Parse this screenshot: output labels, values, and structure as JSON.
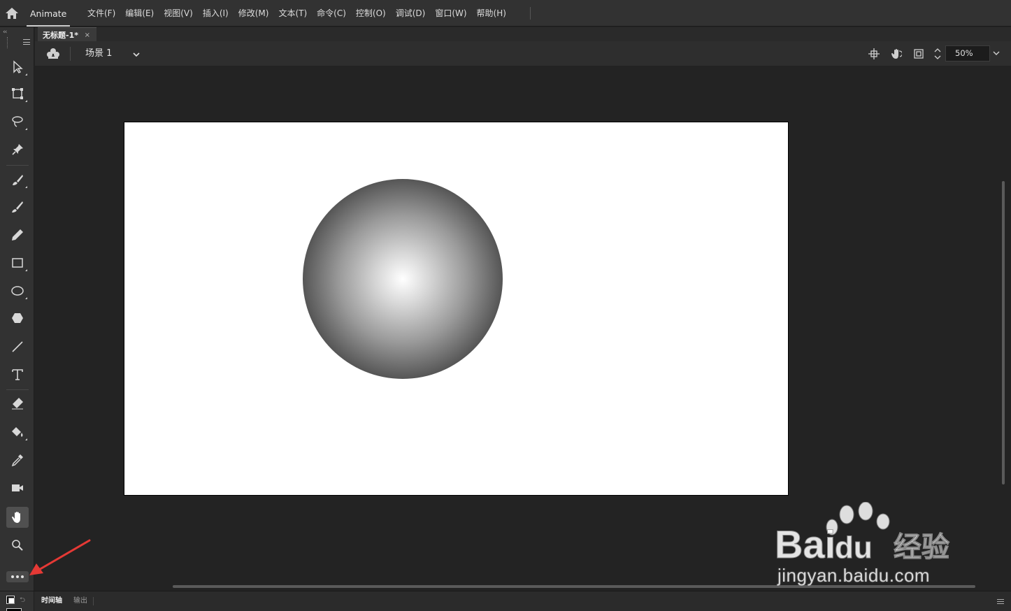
{
  "app": {
    "name": "Animate"
  },
  "menu": {
    "items": [
      "文件(F)",
      "编辑(E)",
      "视图(V)",
      "插入(I)",
      "修改(M)",
      "文本(T)",
      "命令(C)",
      "控制(O)",
      "调试(D)",
      "窗口(W)",
      "帮助(H)"
    ]
  },
  "document": {
    "tab_title": "无标题-1*",
    "close_glyph": "×"
  },
  "scene": {
    "label": "场景 1",
    "zoom": "50%"
  },
  "toolbar": {
    "collapse_glyph": "‹‹",
    "tools": [
      "selection-tool",
      "free-transform-tool",
      "lasso-tool",
      "pin-tool",
      "paint-brush-tool",
      "brush-tool",
      "pencil-tool",
      "rectangle-tool",
      "oval-tool",
      "polystar-tool",
      "line-tool",
      "text-tool",
      "eraser-tool",
      "paint-bucket-tool",
      "eyedropper-tool",
      "camera-tool",
      "hand-tool",
      "zoom-tool"
    ],
    "active_tool": "hand-tool"
  },
  "bottom_panel": {
    "tabs": [
      "时间轴",
      "输出"
    ],
    "active": "时间轴",
    "swap_glyph": "⮌"
  },
  "colors": {
    "ui_background": "#232323",
    "panel": "#323232",
    "stage": "#ffffff",
    "gradient_center": "#ffffff",
    "gradient_edge": "#000000",
    "annotation_arrow": "#e53935"
  },
  "watermark": {
    "brand": "Bai",
    "brand_suffix": "经验",
    "url": "jingyan.baidu.com"
  }
}
